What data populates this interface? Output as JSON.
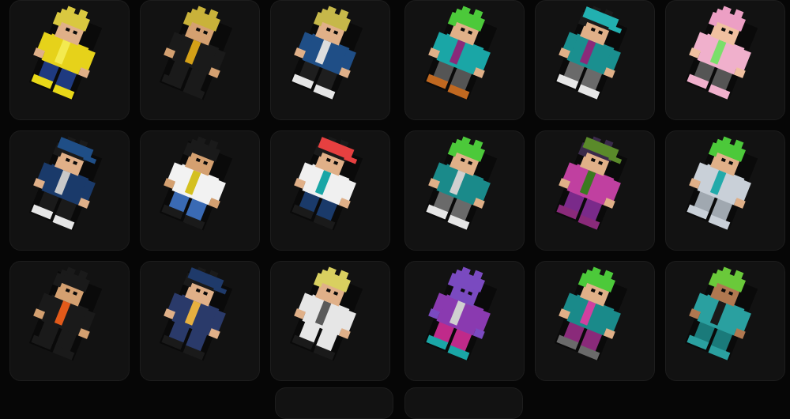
{
  "grid": {
    "columns": 6,
    "rows": 3,
    "background_color": "#060606",
    "card_color": "#121212"
  },
  "characters": [
    {
      "name": "blonde-yellow-outfit",
      "hair": "#d9c840",
      "skin": "#e0b088",
      "top": "#e6d21a",
      "bottom": "#1f3a80",
      "shoes": "#e8d818",
      "accent": "#f3ea50",
      "hat": ""
    },
    {
      "name": "blonde-black-gold",
      "hair": "#c9b23a",
      "skin": "#d4a070",
      "top": "#1a1a1a",
      "bottom": "#1a1a1a",
      "shoes": "#1a1a1a",
      "accent": "#d4a017",
      "hat": ""
    },
    {
      "name": "blonde-blue-jacket",
      "hair": "#c6b84a",
      "skin": "#e0b088",
      "top": "#1f4e86",
      "bottom": "#1e1e1e",
      "shoes": "#e6e6e6",
      "accent": "#dddddd",
      "hat": ""
    },
    {
      "name": "green-hair-teal",
      "hair": "#4cc93a",
      "skin": "#e0b088",
      "top": "#1aa6a6",
      "bottom": "#555555",
      "shoes": "#c06820",
      "accent": "#8a2a7a",
      "hat": ""
    },
    {
      "name": "teal-cap-grey",
      "hair": "#1a1a1a",
      "skin": "#e0b088",
      "top": "#1a8f8f",
      "bottom": "#6a6a6a",
      "shoes": "#e6e6e6",
      "accent": "#8a2a7a",
      "hat": "#22b0b0"
    },
    {
      "name": "pink-hood",
      "hair": "#ec9fc4",
      "skin": "#f0c0a0",
      "top": "#f0b0cc",
      "bottom": "#555555",
      "shoes": "#f0b0cc",
      "accent": "#7adf6a",
      "hat": ""
    },
    {
      "name": "blue-cap-black",
      "hair": "#1a1a1a",
      "skin": "#e0b088",
      "top": "#1a3a6a",
      "bottom": "#1a1a1a",
      "shoes": "#e6e6e6",
      "accent": "#c9c9c9",
      "hat": "#1f4e86"
    },
    {
      "name": "white-tee-jeans",
      "hair": "#1a1a1a",
      "skin": "#d4a070",
      "top": "#f2f2f2",
      "bottom": "#3a6ab4",
      "shoes": "#1a1a1a",
      "accent": "#d4c020",
      "hat": ""
    },
    {
      "name": "red-cap-trainer",
      "hair": "#1a1a1a",
      "skin": "#e0b088",
      "top": "#f0f0f0",
      "bottom": "#1a3a6a",
      "shoes": "#1a1a1a",
      "accent": "#1aa6a6",
      "hat": "#e64040"
    },
    {
      "name": "green-hair-grey-coat",
      "hair": "#4cc93a",
      "skin": "#e0b088",
      "top": "#1a8a8a",
      "bottom": "#6a6a6a",
      "shoes": "#e6e6e6",
      "accent": "#d0d0d0",
      "hat": ""
    },
    {
      "name": "guitar-witch",
      "hair": "#3a2a4a",
      "skin": "#e0b088",
      "top": "#c040a0",
      "bottom": "#7a2a8a",
      "shoes": "#8a2a7a",
      "accent": "#3a7a20",
      "hat": "#5a8a2a"
    },
    {
      "name": "silver-armor",
      "hair": "#4cc93a",
      "skin": "#e0b088",
      "top": "#c9d0d8",
      "bottom": "#a0a8b0",
      "shoes": "#c9d0d8",
      "accent": "#22aaaa",
      "hat": ""
    },
    {
      "name": "black-orange-ninja",
      "hair": "#1a1a1a",
      "skin": "#d4a070",
      "top": "#1a1a1a",
      "bottom": "#1a1a1a",
      "shoes": "#1a1a1a",
      "accent": "#e25a1a",
      "hat": ""
    },
    {
      "name": "police-officer",
      "hair": "#1a1a1a",
      "skin": "#e0b088",
      "top": "#2a3a6a",
      "bottom": "#2a3a6a",
      "shoes": "#1a1a1a",
      "accent": "#e6b040",
      "hat": "#1f3a6a"
    },
    {
      "name": "blonde-white-gi",
      "hair": "#d9d060",
      "skin": "#e0b088",
      "top": "#e6e6e6",
      "bottom": "#e6e6e6",
      "shoes": "#1a1a1a",
      "accent": "#5a5a5a",
      "hat": ""
    },
    {
      "name": "purple-ghost",
      "hair": "#7a4ac0",
      "skin": "#7a4ac0",
      "top": "#8a3ab0",
      "bottom": "#c02a8a",
      "shoes": "#1aa6a6",
      "accent": "#d0d0d0",
      "hat": ""
    },
    {
      "name": "green-hair-magenta",
      "hair": "#4cc93a",
      "skin": "#e0b088",
      "top": "#1a8a8a",
      "bottom": "#8a2a7a",
      "shoes": "#6a6a6a",
      "accent": "#d040a0",
      "hat": ""
    },
    {
      "name": "green-hair-teal-robe",
      "hair": "#6ac93a",
      "skin": "#b07850",
      "top": "#2aa0a0",
      "bottom": "#1a7a7a",
      "shoes": "#2aa0a0",
      "accent": "#1a1a1a",
      "hat": ""
    }
  ]
}
